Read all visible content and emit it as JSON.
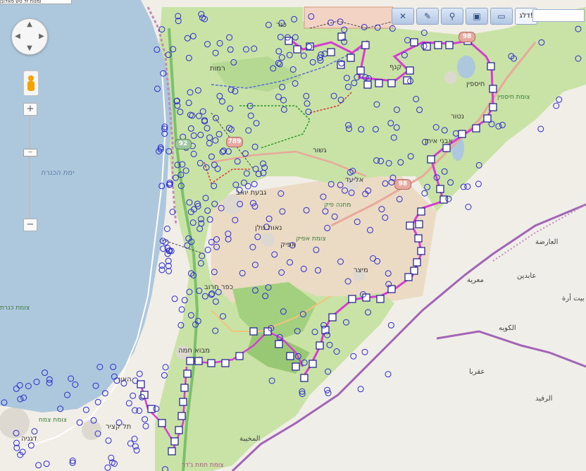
{
  "toolbar": {
    "buttons": [
      {
        "name": "close-icon",
        "glyph": "✕"
      },
      {
        "name": "pencil-icon",
        "glyph": "✎"
      },
      {
        "name": "pin-icon",
        "glyph": "⚲"
      },
      {
        "name": "save-icon",
        "glyph": "▣"
      },
      {
        "name": "folder-icon",
        "glyph": "▭"
      }
    ],
    "text_button": "דלג!",
    "search_value": "",
    "top_strip_text": "ומנוח זל טשׂ פאלוב"
  },
  "navigation": {
    "pan_arrows": {
      "up": "▲",
      "down": "▼",
      "left": "◀",
      "right": "▶"
    },
    "zoom_in": "+",
    "zoom_out": "−",
    "zoom_handle": "−"
  },
  "map_labels": {
    "lake": "ימת הכנרת",
    "places": {
      "kinneret": "כנרת",
      "ramot": "רמות",
      "givat_yoav": "גבעת יואב",
      "neot_golan": "נאות גולן",
      "afik": "אפיק",
      "kfar_haruv": "כפר חרוב",
      "mevo_hama": "מבוא חמה",
      "tel_katzir": "תל קציר",
      "degania": "דגניה",
      "haon": "האון",
      "giv_a": "גשור",
      "eliad": "אליעד",
      "bnei_yehuda": "אבני איתן",
      "natur": "נטור",
      "kanaf": "קנף",
      "yonatan": "יונתן",
      "hispin": "חיספין",
      "mitzar": "מיצר",
      "mahane_pik": "מחנה פיק",
      "ein_gev": "כנר"
    },
    "arabic": {
      "al_arisa": "العارضة",
      "maariya": "معرية",
      "abdin": "عابدين",
      "bait_ara": "بيت أرة",
      "al_kuwaya": "الكويه",
      "aqraba": "عقربا",
      "al_rafid": "الرفيد",
      "al_mukheiba": "المخيبة"
    },
    "roads": {
      "afik_road": "צומת אפיק",
      "hispin_road": "צומת חיספין",
      "zemah_road": "צומת צמח",
      "hamat_road": "צומת חמת ג'דר",
      "kinneret_road": "צומת כנרת"
    },
    "shields": [
      "92",
      "98",
      "789",
      "98"
    ]
  }
}
